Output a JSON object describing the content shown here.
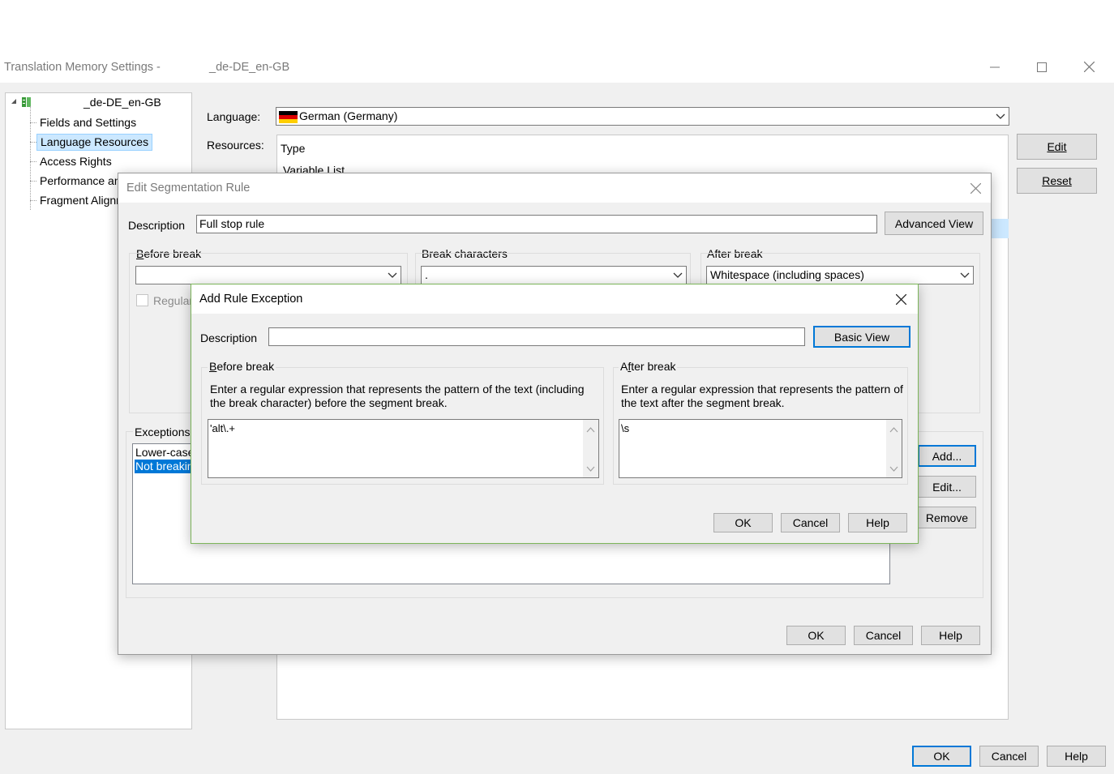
{
  "main_window": {
    "title_prefix": "Translation Memory Settings -",
    "title_suffix": "_de-DE_en-GB",
    "tree": {
      "root": "_de-DE_en-GB",
      "items": [
        "Fields and Settings",
        "Language Resources",
        "Access Rights",
        "Performance and Tuning",
        "Fragment Alignment"
      ],
      "selected": "Language Resources"
    },
    "language_label": "Language:",
    "language_value": "German (Germany)",
    "resources_label": "Resources:",
    "resources_header": "Type",
    "resources_rows": [
      "Variable List"
    ],
    "edit_button": "Edit",
    "reset_button": "Reset",
    "ok_button": "OK",
    "cancel_button": "Cancel",
    "help_button": "Help"
  },
  "seg_dialog": {
    "title": "Edit Segmentation Rule",
    "description_label": "Description",
    "description_value": "Full stop rule",
    "advanced_view_button": "Advanced View",
    "before_break_label": "Before break",
    "before_break_value": "",
    "break_chars_label": "Break characters",
    "break_chars_value": ".",
    "after_break_label": "After break",
    "after_break_value": "Whitespace (including spaces)",
    "regex_checkbox_label": "Regular expression",
    "exceptions_label": "Exceptions",
    "exceptions": [
      "Lower-case letter",
      "Not breaking"
    ],
    "add_button": "Add...",
    "edit_button": "Edit...",
    "remove_button": "Remove",
    "ok_button": "OK",
    "cancel_button": "Cancel",
    "help_button": "Help"
  },
  "exc_dialog": {
    "title": "Add Rule Exception",
    "description_label": "Description",
    "description_value": "",
    "basic_view_button": "Basic View",
    "before_break_label": "Before break",
    "before_break_help": "Enter a regular expression that represents the pattern of the text (including the break character) before the segment break.",
    "before_break_value": "'alt\\.+",
    "after_break_label": "After break",
    "after_break_help": "Enter a regular expression that represents the pattern of the text after the segment break.",
    "after_break_value": "\\s",
    "ok_button": "OK",
    "cancel_button": "Cancel",
    "help_button": "Help"
  },
  "colors": {
    "selection": "#cce8ff",
    "list_selection": "#0078d7",
    "dialog_border_active": "#7cb55a",
    "default_button_border": "#0078d7"
  }
}
